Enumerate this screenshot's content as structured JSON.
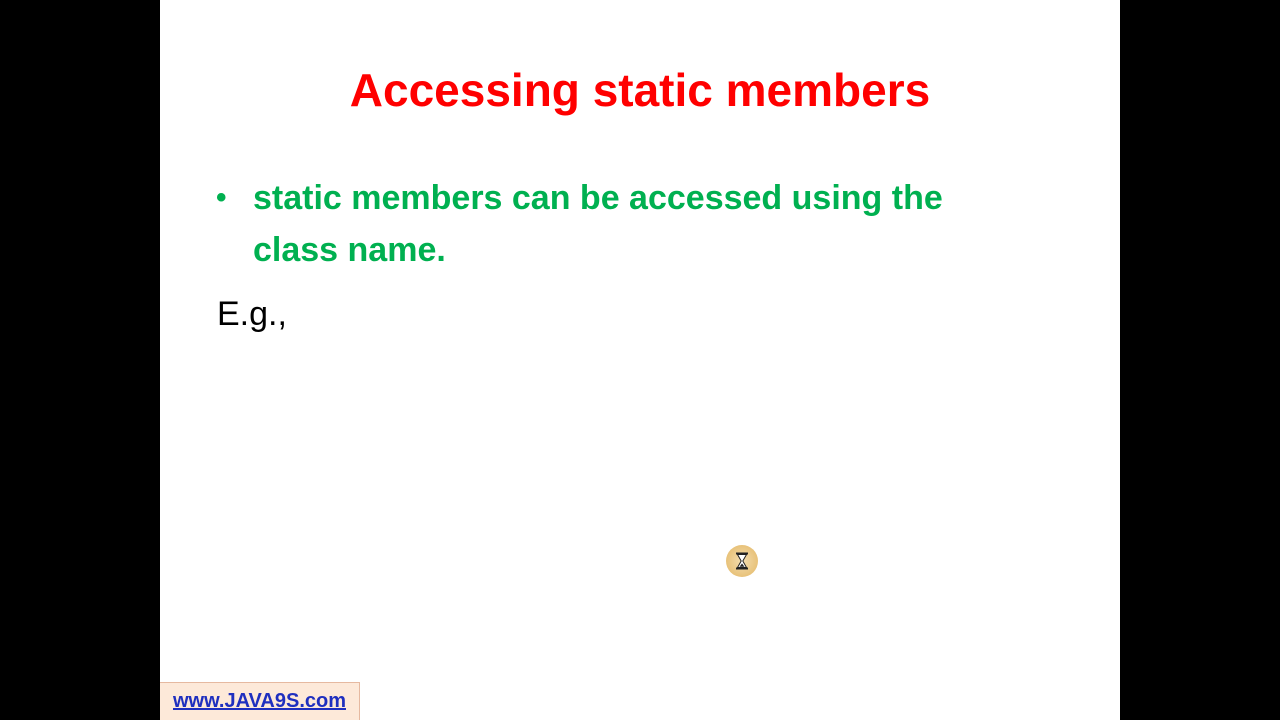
{
  "slide": {
    "title": "Accessing static members",
    "bullets": [
      {
        "text": "static members can be accessed using the class name."
      }
    ],
    "example_label": "E.g.,",
    "watermark": "www.JAVA9S.com",
    "cursor_icon": "hourglass-icon"
  },
  "colors": {
    "title": "#ff0000",
    "bullet": "#00b050",
    "watermark_link": "#1f2fbf",
    "watermark_bg": "#fde9d9",
    "letterbox": "#000000"
  }
}
